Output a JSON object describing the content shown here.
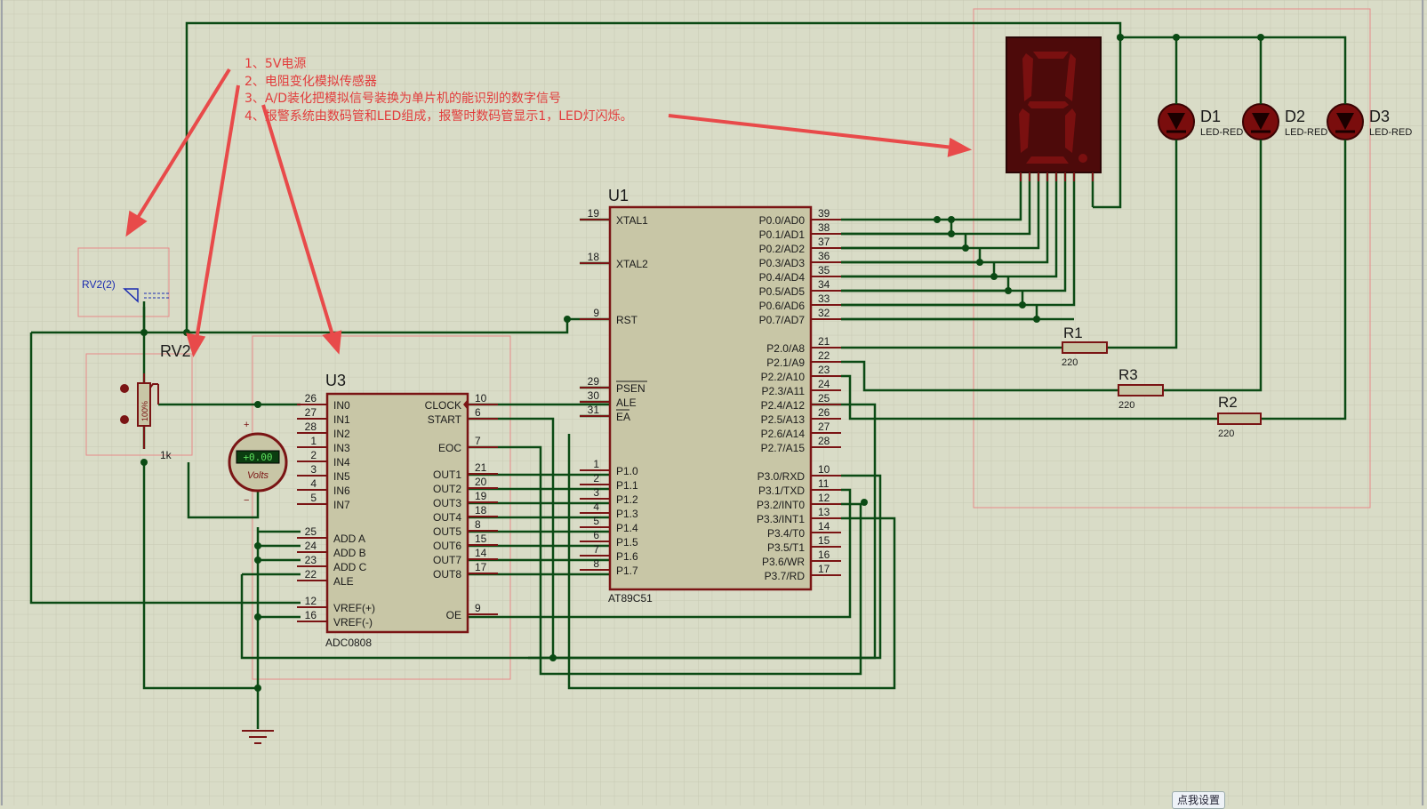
{
  "notes": [
    "1、5V电源",
    "2、电阻变化模拟传感器",
    "3、A/D装化把模拟信号装换为单片机的能识别的数字信号",
    "4、报警系统由数码管和LED组成，报警时数码管显示1，LED灯闪烁。"
  ],
  "rv2": {
    "ref": "RV2",
    "value": "1k",
    "pct": "100%",
    "probe": "RV2(2)"
  },
  "voltmeter": {
    "display": "+0.00",
    "unit": "Volts",
    "plus": "+",
    "minus": "−"
  },
  "u3": {
    "ref": "U3",
    "part": "ADC0808",
    "left_pins": [
      {
        "num": "26",
        "name": "IN0"
      },
      {
        "num": "27",
        "name": "IN1"
      },
      {
        "num": "28",
        "name": "IN2"
      },
      {
        "num": "1",
        "name": "IN3"
      },
      {
        "num": "2",
        "name": "IN4"
      },
      {
        "num": "3",
        "name": "IN5"
      },
      {
        "num": "4",
        "name": "IN6"
      },
      {
        "num": "5",
        "name": "IN7"
      },
      {
        "num": "25",
        "name": "ADD A"
      },
      {
        "num": "24",
        "name": "ADD B"
      },
      {
        "num": "23",
        "name": "ADD C"
      },
      {
        "num": "22",
        "name": "ALE"
      },
      {
        "num": "12",
        "name": "VREF(+)"
      },
      {
        "num": "16",
        "name": "VREF(-)"
      }
    ],
    "right_pins": [
      {
        "num": "10",
        "name": "CLOCK"
      },
      {
        "num": "6",
        "name": "START"
      },
      {
        "num": "7",
        "name": "EOC"
      },
      {
        "num": "21",
        "name": "OUT1"
      },
      {
        "num": "20",
        "name": "OUT2"
      },
      {
        "num": "19",
        "name": "OUT3"
      },
      {
        "num": "18",
        "name": "OUT4"
      },
      {
        "num": "8",
        "name": "OUT5"
      },
      {
        "num": "15",
        "name": "OUT6"
      },
      {
        "num": "14",
        "name": "OUT7"
      },
      {
        "num": "17",
        "name": "OUT8"
      },
      {
        "num": "9",
        "name": "OE"
      }
    ]
  },
  "u1": {
    "ref": "U1",
    "part": "AT89C51",
    "left_pins": [
      {
        "num": "19",
        "name": "XTAL1"
      },
      {
        "num": "18",
        "name": "XTAL2"
      },
      {
        "num": "9",
        "name": "RST"
      },
      {
        "num": "29",
        "name": "PSEN"
      },
      {
        "num": "30",
        "name": "ALE"
      },
      {
        "num": "31",
        "name": "EA"
      },
      {
        "num": "1",
        "name": "P1.0"
      },
      {
        "num": "2",
        "name": "P1.1"
      },
      {
        "num": "3",
        "name": "P1.2"
      },
      {
        "num": "4",
        "name": "P1.3"
      },
      {
        "num": "5",
        "name": "P1.4"
      },
      {
        "num": "6",
        "name": "P1.5"
      },
      {
        "num": "7",
        "name": "P1.6"
      },
      {
        "num": "8",
        "name": "P1.7"
      }
    ],
    "right_pins": [
      {
        "num": "39",
        "name": "P0.0/AD0"
      },
      {
        "num": "38",
        "name": "P0.1/AD1"
      },
      {
        "num": "37",
        "name": "P0.2/AD2"
      },
      {
        "num": "36",
        "name": "P0.3/AD3"
      },
      {
        "num": "35",
        "name": "P0.4/AD4"
      },
      {
        "num": "34",
        "name": "P0.5/AD5"
      },
      {
        "num": "33",
        "name": "P0.6/AD6"
      },
      {
        "num": "32",
        "name": "P0.7/AD7"
      },
      {
        "num": "21",
        "name": "P2.0/A8"
      },
      {
        "num": "22",
        "name": "P2.1/A9"
      },
      {
        "num": "23",
        "name": "P2.2/A10"
      },
      {
        "num": "24",
        "name": "P2.3/A11"
      },
      {
        "num": "25",
        "name": "P2.4/A12"
      },
      {
        "num": "26",
        "name": "P2.5/A13"
      },
      {
        "num": "27",
        "name": "P2.6/A14"
      },
      {
        "num": "28",
        "name": "P2.7/A15"
      },
      {
        "num": "10",
        "name": "P3.0/RXD"
      },
      {
        "num": "11",
        "name": "P3.1/TXD"
      },
      {
        "num": "12",
        "name": "P3.2/INT0"
      },
      {
        "num": "13",
        "name": "P3.3/INT1"
      },
      {
        "num": "14",
        "name": "P3.4/T0"
      },
      {
        "num": "15",
        "name": "P3.5/T1"
      },
      {
        "num": "16",
        "name": "P3.6/WR"
      },
      {
        "num": "17",
        "name": "P3.7/RD"
      }
    ]
  },
  "resistors": [
    {
      "ref": "R1",
      "value": "220"
    },
    {
      "ref": "R3",
      "value": "220"
    },
    {
      "ref": "R2",
      "value": "220"
    }
  ],
  "leds": [
    {
      "ref": "D1",
      "type": "LED-RED"
    },
    {
      "ref": "D2",
      "type": "LED-RED"
    },
    {
      "ref": "D3",
      "type": "LED-RED"
    }
  ],
  "colors": {
    "background": "#d9dcc7",
    "grid": "#c8cbb5",
    "wire": "#0b4a14",
    "component": "#7a1414",
    "chip_fill": "#c8c6a6",
    "annotation": "#e23b3b",
    "segment_body": "#4d0a0a",
    "segment_off": "#7a1010"
  },
  "settings_button": "点我设置"
}
